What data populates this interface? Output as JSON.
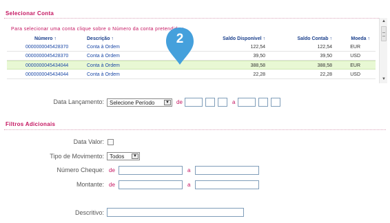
{
  "section1": {
    "title": "Selecionar Conta",
    "instruction": "Para selecionar uma conta clique sobre o Número da conta pretendida :"
  },
  "table": {
    "headers": {
      "numero": "Número ↑",
      "descricao": "Descrição ↑",
      "saldo_disponivel": "Saldo Disponível ↑",
      "saldo_contab": "Saldo Contab ↑",
      "moeda": "Moeda ↑"
    },
    "rows": [
      {
        "numero": "0000000045428370",
        "descricao": "Conta à Ordem",
        "saldo_disponivel": "122,54",
        "saldo_contab": "122,54",
        "moeda": "EUR",
        "selected": false
      },
      {
        "numero": "0000000045428370",
        "descricao": "Conta à Ordem",
        "saldo_disponivel": "39,50",
        "saldo_contab": "39,50",
        "moeda": "USD",
        "selected": false
      },
      {
        "numero": "0000000045434044",
        "descricao": "Conta à Ordem",
        "saldo_disponivel": "388,58",
        "saldo_contab": "388,58",
        "moeda": "EUR",
        "selected": true
      },
      {
        "numero": "0000000045434044",
        "descricao": "Conta à Ordem",
        "saldo_disponivel": "22,28",
        "saldo_contab": "22,28",
        "moeda": "USD",
        "selected": false
      }
    ]
  },
  "marker": {
    "number": "2",
    "color": "#45a0dc"
  },
  "date_filter": {
    "label": "Data Lançamento:",
    "select_value": "Selecione Período",
    "de": "de",
    "a": "a"
  },
  "section2": {
    "title": "Filtros Adicionais"
  },
  "filters": {
    "data_valor_label": "Data Valor:",
    "tipo_movimento_label": "Tipo de Movimento:",
    "tipo_movimento_value": "Todos",
    "numero_cheque_label": "Número Cheque:",
    "montante_label": "Montante:",
    "descritivo_label": "Descritivo:",
    "de": "de",
    "a": "a"
  },
  "colors": {
    "accent": "#c4135f",
    "link": "#1a47a6",
    "selected_row": "#e8f8d4"
  }
}
